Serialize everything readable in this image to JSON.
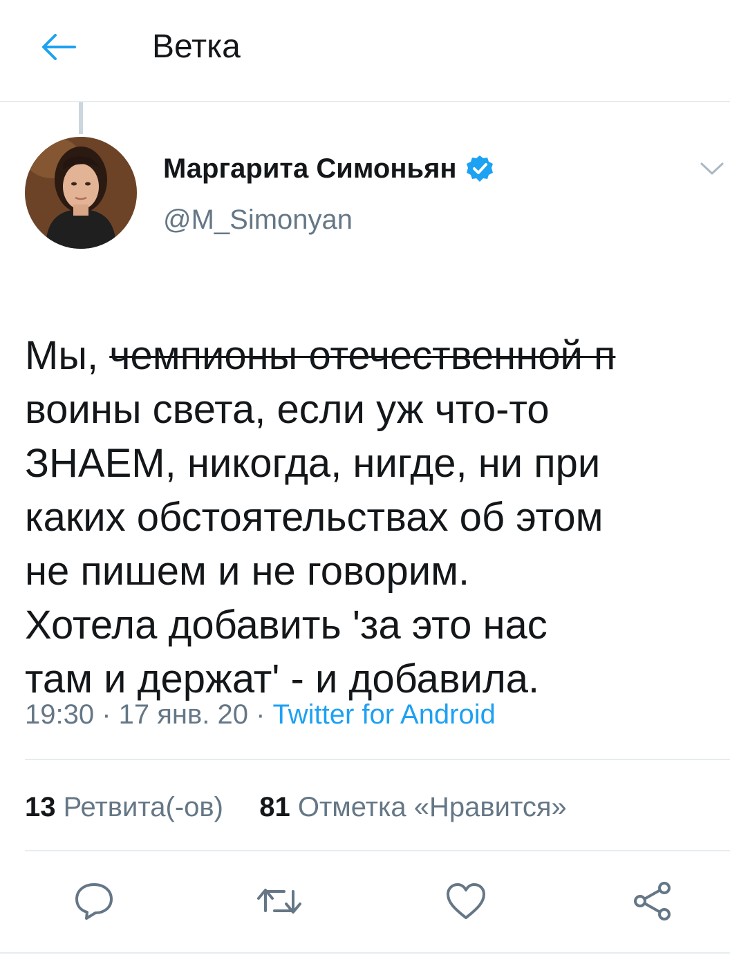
{
  "header": {
    "title": "Ветка",
    "back_icon": "arrow-left-icon",
    "accent_color": "#1da1f2"
  },
  "tweet": {
    "author_name": "Маргарита Симоньян",
    "author_handle": "@M_Simonyan",
    "verified_icon": "verified-badge-icon",
    "menu_icon": "chevron-down-icon",
    "text_lead": "Мы, ",
    "text_struck": "чемпионы отечественной п",
    "text_body": "воины света, если уж что-то\nЗНАЕМ, никогда, нигде, ни при\nкаких обстоятельствах об этом\nне пишем и не говорим.\nХотела добавить 'за это нас\nтам и держат' - и добавила.",
    "timestamp": "19:30 · 17 янв. 20 · ",
    "source": "Twitter for Android"
  },
  "stats": {
    "retweets_count": "13",
    "retweets_label": "Ретвита(-ов)",
    "likes_count": "81",
    "likes_label": "Отметка «Нравится»"
  },
  "actions": {
    "reply_icon": "reply-icon",
    "retweet_icon": "retweet-icon",
    "like_icon": "heart-icon",
    "share_icon": "share-icon"
  },
  "colors": {
    "text_primary": "#14171a",
    "text_secondary": "#657786",
    "link": "#1da1f2",
    "divider": "#e6ecf0"
  }
}
